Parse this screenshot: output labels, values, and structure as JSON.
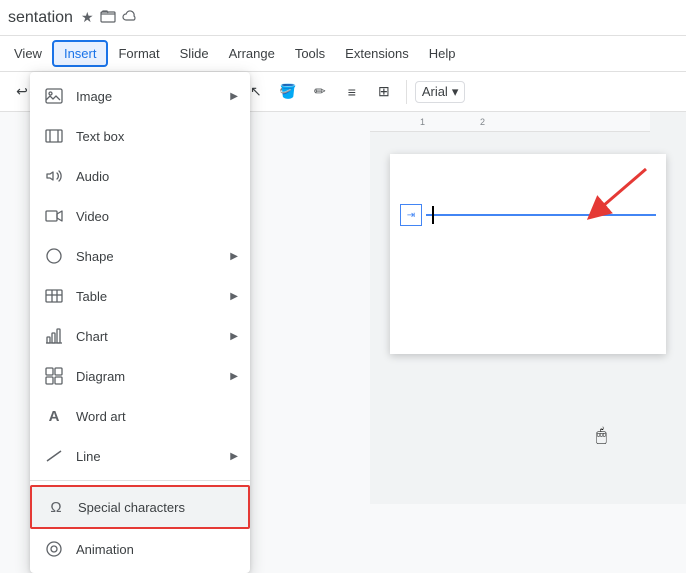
{
  "titleBar": {
    "title": "sentation",
    "starIcon": "★",
    "folderIcon": "📁",
    "cloudIcon": "☁"
  },
  "menuBar": {
    "items": [
      {
        "label": "View",
        "active": false
      },
      {
        "label": "Insert",
        "active": true
      },
      {
        "label": "Format",
        "active": false
      },
      {
        "label": "Slide",
        "active": false
      },
      {
        "label": "Arrange",
        "active": false
      },
      {
        "label": "Tools",
        "active": false
      },
      {
        "label": "Extensions",
        "active": false
      },
      {
        "label": "Help",
        "active": false
      }
    ]
  },
  "toolbar": {
    "fontName": "Arial",
    "arrowIcon": "▾",
    "paintIcon": "🪣",
    "penIcon": "✏",
    "alignIcon": "≡",
    "tableIcon": "⊞"
  },
  "dropdown": {
    "items": [
      {
        "id": "image",
        "label": "Image",
        "icon": "🖼",
        "hasArrow": true
      },
      {
        "id": "textbox",
        "label": "Text box",
        "icon": "⬚",
        "hasArrow": false
      },
      {
        "id": "audio",
        "label": "Audio",
        "icon": "🔊",
        "hasArrow": false
      },
      {
        "id": "video",
        "label": "Video",
        "icon": "📹",
        "hasArrow": false
      },
      {
        "id": "shape",
        "label": "Shape",
        "icon": "⬡",
        "hasArrow": true
      },
      {
        "id": "table",
        "label": "Table",
        "icon": "⊞",
        "hasArrow": true
      },
      {
        "id": "chart",
        "label": "Chart",
        "icon": "📊",
        "hasArrow": true
      },
      {
        "id": "diagram",
        "label": "Diagram",
        "icon": "⬜",
        "hasArrow": true
      },
      {
        "id": "wordart",
        "label": "Word art",
        "icon": "A",
        "hasArrow": false
      },
      {
        "id": "line",
        "label": "Line",
        "icon": "╱",
        "hasArrow": true
      },
      {
        "id": "specialchars",
        "label": "Special characters",
        "icon": "Ω",
        "hasArrow": false,
        "highlighted": true
      },
      {
        "id": "animation",
        "label": "Animation",
        "icon": "◎",
        "hasArrow": false
      }
    ]
  },
  "slideArea": {
    "rulerMarks": [
      "1",
      "2"
    ],
    "textboxIcon": "⇥"
  }
}
